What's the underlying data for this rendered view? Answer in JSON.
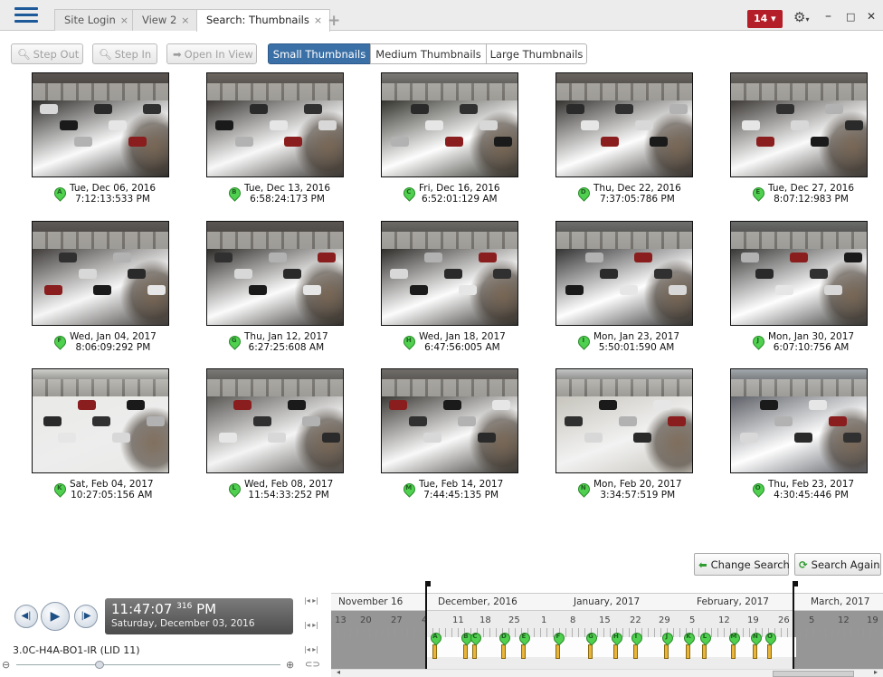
{
  "tabs": [
    {
      "label": "Site Login",
      "close": "×"
    },
    {
      "label": "View 2",
      "close": "×"
    },
    {
      "label": "Search: Thumbnails",
      "close": "×"
    }
  ],
  "tab_add": "+",
  "alerts": {
    "count": "14 ▾"
  },
  "window_controls": {
    "minimize": "–",
    "maximize": "□",
    "close": "✕"
  },
  "toolbar": {
    "step_out": "Step Out",
    "step_in": "Step In",
    "open_in_view": "Open In View",
    "small": "Small Thumbnails",
    "medium": "Medium Thumbnails",
    "large": "Large Thumbnails",
    "selected_size": "Small Thumbnails"
  },
  "thumbnails": [
    {
      "letter": "A",
      "date": "Tue, Dec 06, 2016",
      "time": "7:12:13:533 PM"
    },
    {
      "letter": "B",
      "date": "Tue, Dec 13, 2016",
      "time": "6:58:24:173 PM"
    },
    {
      "letter": "C",
      "date": "Fri, Dec 16, 2016",
      "time": "6:52:01:129 AM"
    },
    {
      "letter": "D",
      "date": "Thu, Dec 22, 2016",
      "time": "7:37:05:786 PM"
    },
    {
      "letter": "E",
      "date": "Tue, Dec 27, 2016",
      "time": "8:07:12:983 PM"
    },
    {
      "letter": "F",
      "date": "Wed, Jan 04, 2017",
      "time": "8:06:09:292 PM"
    },
    {
      "letter": "G",
      "date": "Thu, Jan 12, 2017",
      "time": "6:27:25:608 AM"
    },
    {
      "letter": "H",
      "date": "Wed, Jan 18, 2017",
      "time": "6:47:56:005 AM"
    },
    {
      "letter": "I",
      "date": "Mon, Jan 23, 2017",
      "time": "5:50:01:590 AM"
    },
    {
      "letter": "J",
      "date": "Mon, Jan 30, 2017",
      "time": "6:07:10:756 AM"
    },
    {
      "letter": "K",
      "date": "Sat, Feb 04, 2017",
      "time": "10:27:05:156 AM"
    },
    {
      "letter": "L",
      "date": "Wed, Feb 08, 2017",
      "time": "11:54:33:252 PM"
    },
    {
      "letter": "M",
      "date": "Tue, Feb 14, 2017",
      "time": "7:44:45:135 PM"
    },
    {
      "letter": "N",
      "date": "Mon, Feb 20, 2017",
      "time": "3:34:57:519 PM"
    },
    {
      "letter": "O",
      "date": "Thu, Feb 23, 2017",
      "time": "4:30:45:446 PM"
    }
  ],
  "actions": {
    "change_search": "Change Search",
    "search_again": "Search Again"
  },
  "playback": {
    "time": "11:47:07",
    "ms": "316",
    "ampm": "PM",
    "date": "Saturday, December 03, 2016",
    "camera": "3.0C-H4A-BO1-IR (LID 11)"
  },
  "timeline": {
    "months": [
      "November 16",
      "December, 2016",
      "January, 2017",
      "February, 2017",
      "March, 2017"
    ],
    "days": [
      "13",
      "20",
      "27",
      "4",
      "11",
      "18",
      "25",
      "1",
      "8",
      "15",
      "22",
      "29",
      "5",
      "12",
      "19",
      "26",
      "5",
      "12",
      "19"
    ],
    "event_letters": [
      "A",
      "B",
      "C",
      "D",
      "E",
      "F",
      "G",
      "H",
      "I",
      "J",
      "K",
      "L",
      "M",
      "N",
      "O"
    ]
  },
  "colors": {
    "accent": "#3b70a6",
    "alert": "#b41e28",
    "event_pin": "#4fd04f",
    "event_bar": "#e8b43a"
  }
}
